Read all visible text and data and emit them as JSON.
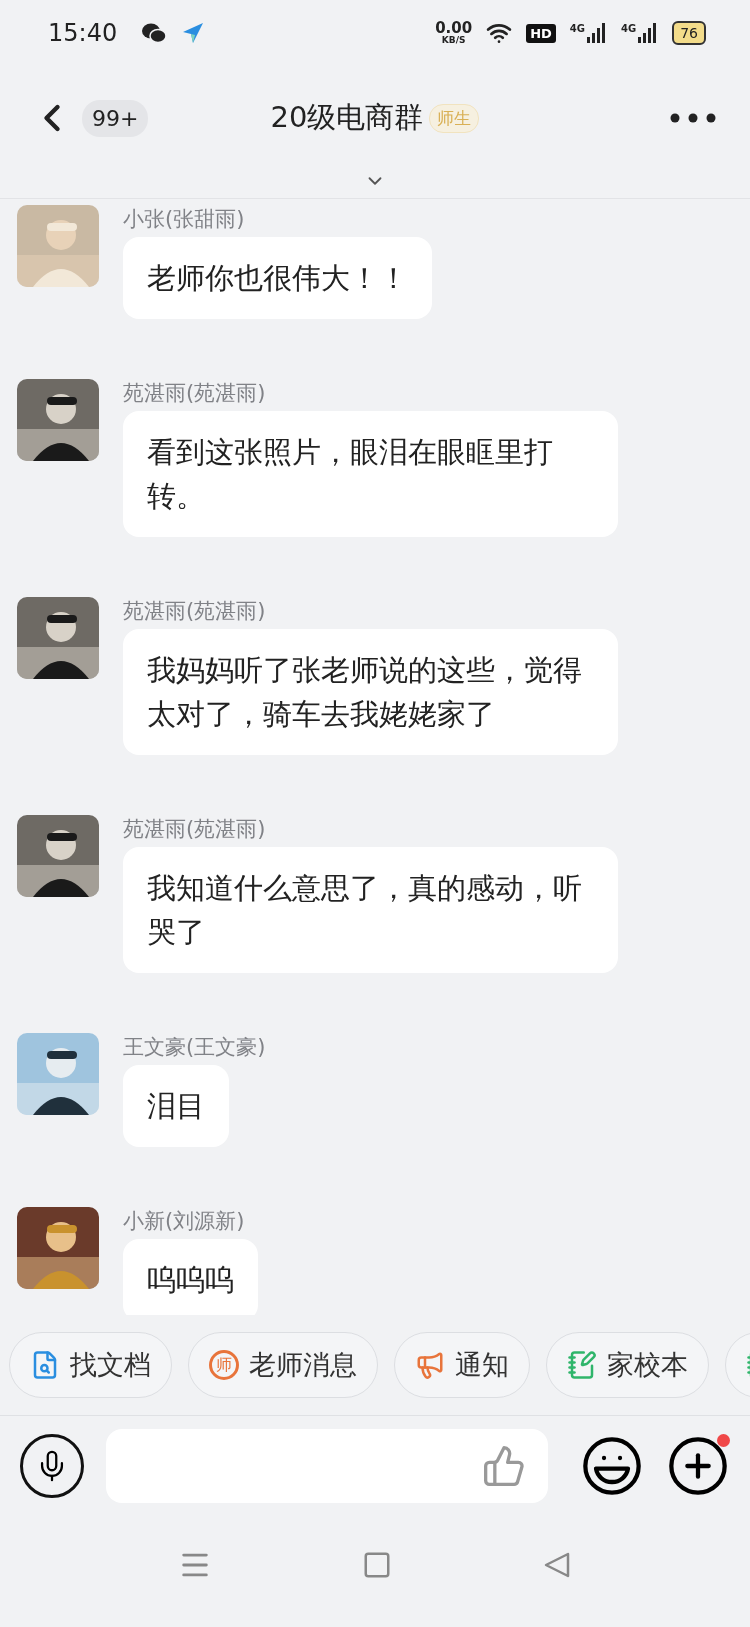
{
  "status_bar": {
    "time": "15:40",
    "net_speed": "0.00",
    "net_unit": "KB/S",
    "hd": "HD",
    "signals": [
      "4G",
      "4G"
    ],
    "battery": "76"
  },
  "header": {
    "unread": "99+",
    "title": "20级电商群",
    "tag": "师生"
  },
  "messages": [
    {
      "sender": "小张(张甜雨)",
      "text": "老师你也很伟大！！"
    },
    {
      "sender": "苑湛雨(苑湛雨)",
      "text": "看到这张照片，眼泪在眼眶里打转。"
    },
    {
      "sender": "苑湛雨(苑湛雨)",
      "text": "我妈妈听了张老师说的这些，觉得太对了，骑车去我姥姥家了"
    },
    {
      "sender": "苑湛雨(苑湛雨)",
      "text": "我知道什么意思了，真的感动，听哭了"
    },
    {
      "sender": "王文豪(王文豪)",
      "text": "泪目"
    },
    {
      "sender": "小新(刘源新)",
      "text": "呜呜呜"
    }
  ],
  "shortcuts": [
    {
      "kind": "search",
      "label": "找文档"
    },
    {
      "kind": "teacher",
      "icon_text": "师",
      "label": "老师消息"
    },
    {
      "kind": "notice",
      "label": "通知"
    },
    {
      "kind": "homework",
      "label": "家校本"
    },
    {
      "kind": "homework"
    }
  ],
  "composer": {
    "plus_badge": true
  }
}
